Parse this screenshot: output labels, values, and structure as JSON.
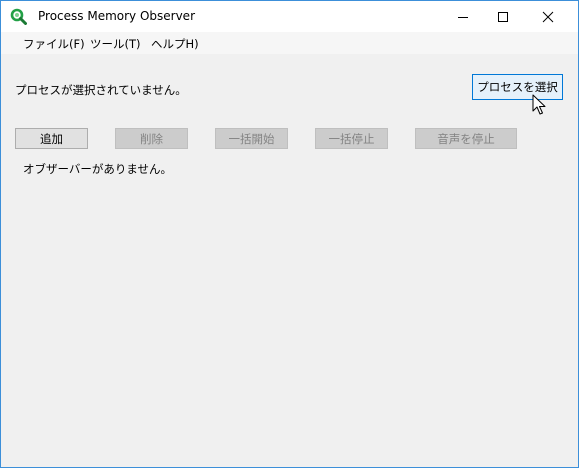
{
  "window": {
    "title": "Process Memory Observer",
    "app_icon": "magnifier-icon",
    "accent_color": "#0078d7",
    "border_color": "#3c8fd9"
  },
  "menu": {
    "items": [
      {
        "label": "ファイル(F)"
      },
      {
        "label": "ツール(T)"
      },
      {
        "label": "ヘルプH)"
      }
    ]
  },
  "process": {
    "status_text": "プロセスが選択されていません。",
    "select_button_label": "プロセスを選択"
  },
  "toolbar": {
    "buttons": [
      {
        "label": "追加",
        "enabled": true
      },
      {
        "label": "削除",
        "enabled": false
      },
      {
        "label": "一括開始",
        "enabled": false
      },
      {
        "label": "一括停止",
        "enabled": false
      },
      {
        "label": "音声を停止",
        "enabled": false
      }
    ]
  },
  "observers": {
    "empty_text": "オブザーバーがありません。"
  }
}
